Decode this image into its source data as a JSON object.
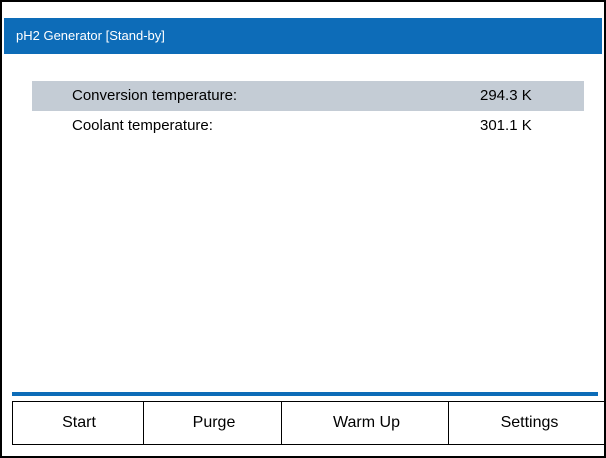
{
  "window": {
    "title": "pH2 Generator  [Stand-by]"
  },
  "readings": [
    {
      "label": "Conversion temperature:",
      "value": "294.3 K",
      "highlighted": true
    },
    {
      "label": "Coolant temperature:",
      "value": "301.1 K",
      "highlighted": false
    }
  ],
  "toolbar": {
    "start_label": "Start",
    "purge_label": "Purge",
    "warmup_label": "Warm Up",
    "settings_label": "Settings"
  },
  "colors": {
    "titlebar": "#0d6cb8",
    "highlight_row": "#c4ccd5",
    "separator": "#0d6cb8"
  }
}
